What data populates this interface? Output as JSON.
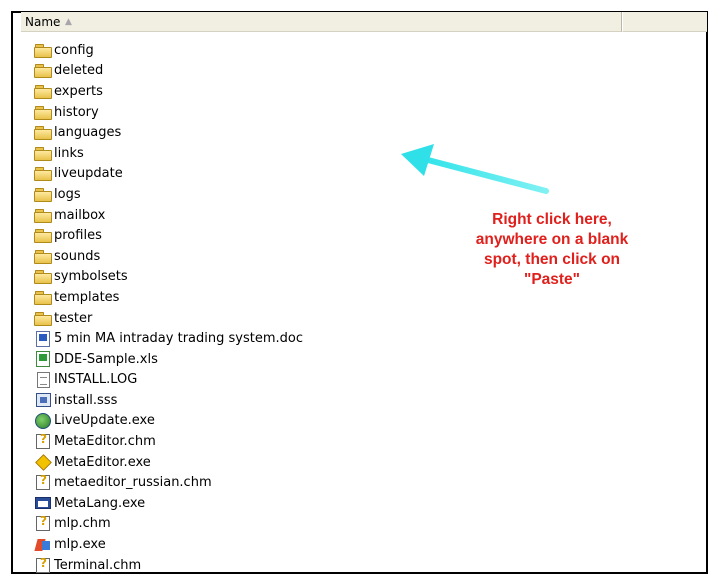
{
  "header": {
    "name_label": "Name",
    "sort_indicator": "▲"
  },
  "files": [
    {
      "name": "config",
      "icon": "folder-icon"
    },
    {
      "name": "deleted",
      "icon": "folder-icon"
    },
    {
      "name": "experts",
      "icon": "folder-icon"
    },
    {
      "name": "history",
      "icon": "folder-icon"
    },
    {
      "name": "languages",
      "icon": "folder-icon"
    },
    {
      "name": "links",
      "icon": "folder-icon"
    },
    {
      "name": "liveupdate",
      "icon": "folder-icon"
    },
    {
      "name": "logs",
      "icon": "folder-icon"
    },
    {
      "name": "mailbox",
      "icon": "folder-icon"
    },
    {
      "name": "profiles",
      "icon": "folder-icon"
    },
    {
      "name": "sounds",
      "icon": "folder-icon"
    },
    {
      "name": "symbolsets",
      "icon": "folder-icon"
    },
    {
      "name": "templates",
      "icon": "folder-icon"
    },
    {
      "name": "tester",
      "icon": "folder-icon"
    },
    {
      "name": "5 min MA intraday trading system.doc",
      "icon": "word-doc-icon"
    },
    {
      "name": "DDE-Sample.xls",
      "icon": "excel-xls-icon"
    },
    {
      "name": "INSTALL.LOG",
      "icon": "text-file-icon"
    },
    {
      "name": "install.sss",
      "icon": "sss-file-icon"
    },
    {
      "name": "LiveUpdate.exe",
      "icon": "liveupdate-exe-icon"
    },
    {
      "name": "MetaEditor.chm",
      "icon": "chm-help-icon"
    },
    {
      "name": "MetaEditor.exe",
      "icon": "metaeditor-exe-icon"
    },
    {
      "name": "metaeditor_russian.chm",
      "icon": "chm-help-icon"
    },
    {
      "name": "MetaLang.exe",
      "icon": "metalang-exe-icon"
    },
    {
      "name": "mlp.chm",
      "icon": "chm-help-icon"
    },
    {
      "name": "mlp.exe",
      "icon": "mlp-exe-icon"
    },
    {
      "name": "Terminal.chm",
      "icon": "chm-help-icon"
    }
  ],
  "annotation": {
    "lines": [
      "Right click here,",
      "anywhere on a blank",
      "spot, then click on",
      "\"Paste\""
    ],
    "text_color": "#e0201c",
    "arrow_color": "#33e0e8"
  }
}
